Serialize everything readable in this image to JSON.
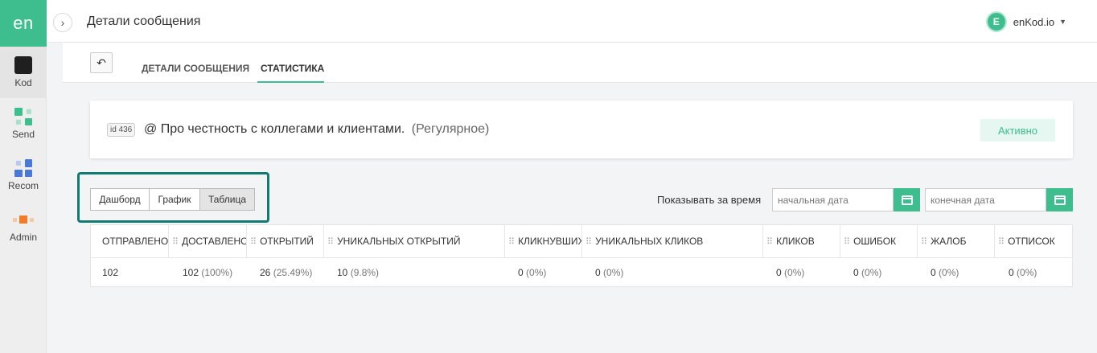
{
  "sidebar": {
    "logo": "en",
    "items": [
      {
        "label": "Kod"
      },
      {
        "label": "Send"
      },
      {
        "label": "Recom"
      },
      {
        "label": "Admin"
      }
    ]
  },
  "header": {
    "title": "Детали сообщения",
    "account_initial": "E",
    "account_name": "enKod.io"
  },
  "tabs": [
    {
      "label": "ДЕТАЛИ СООБЩЕНИЯ"
    },
    {
      "label": "СТАТИСТИКА"
    }
  ],
  "message": {
    "id_label": "id 436",
    "title": "@ Про честность с коллегами и клиентами.",
    "type": "(Регулярное)",
    "status": "Активно"
  },
  "view_switch": [
    "Дашборд",
    "График",
    "Таблица"
  ],
  "date_filter": {
    "label": "Показывать за время",
    "start_placeholder": "начальная дата",
    "end_placeholder": "конечная дата"
  },
  "table": {
    "headers": [
      "ОТПРАВЛЕНО",
      "ДОСТАВЛЕНО",
      "ОТКРЫТИЙ",
      "УНИКАЛЬНЫХ ОТКРЫТИЙ",
      "КЛИКНУВШИХ",
      "УНИКАЛЬНЫХ КЛИКОВ",
      "КЛИКОВ",
      "ОШИБОК",
      "ЖАЛОБ",
      "ОТПИСОК"
    ],
    "row": [
      {
        "value": "102",
        "pct": ""
      },
      {
        "value": "102",
        "pct": "(100%)"
      },
      {
        "value": "26",
        "pct": "(25.49%)"
      },
      {
        "value": "10",
        "pct": "(9.8%)"
      },
      {
        "value": "0",
        "pct": "(0%)"
      },
      {
        "value": "0",
        "pct": "(0%)"
      },
      {
        "value": "0",
        "pct": "(0%)"
      },
      {
        "value": "0",
        "pct": "(0%)"
      },
      {
        "value": "0",
        "pct": "(0%)"
      },
      {
        "value": "0",
        "pct": "(0%)"
      }
    ]
  },
  "colors": {
    "accent": "#3ebd8e",
    "highlight_border": "#137a72"
  }
}
